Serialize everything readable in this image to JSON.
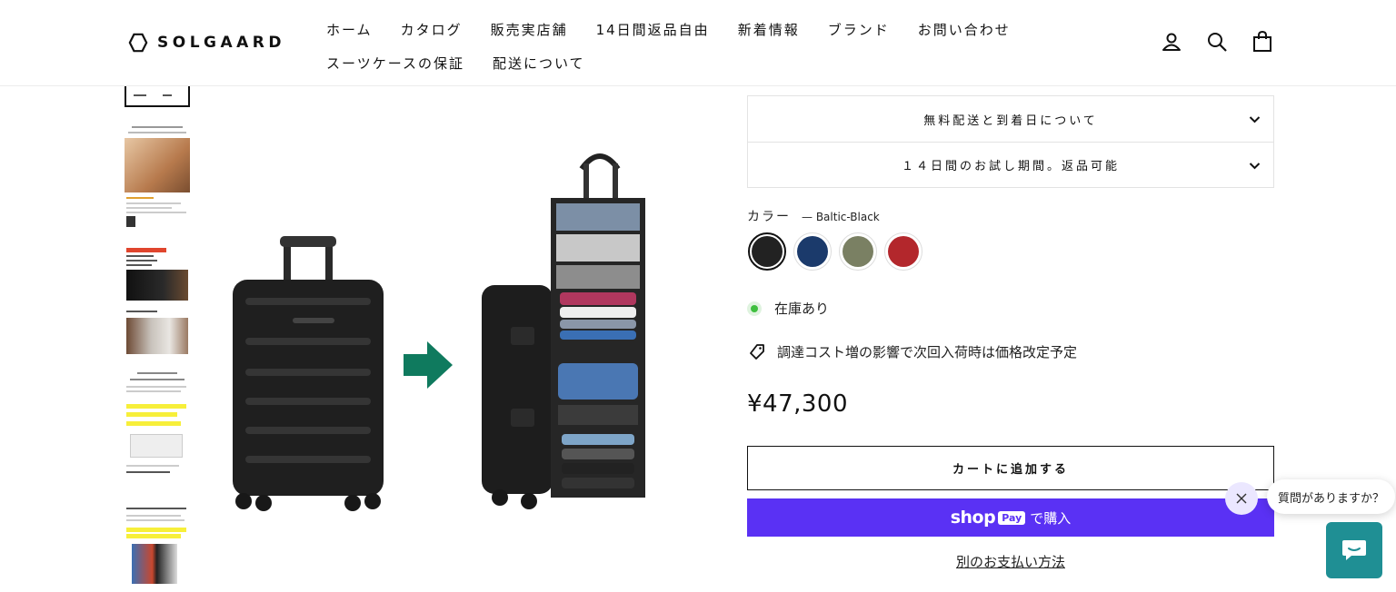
{
  "header": {
    "logo_text": "SOLGAARD",
    "nav_row1": [
      "ホーム",
      "カタログ",
      "販売実店舗",
      "14日間返品自由",
      "新着情報",
      "ブランド",
      "お問い合わせ"
    ],
    "nav_row2": [
      "スーツケースの保証",
      "配送について"
    ],
    "icons": [
      "account-icon",
      "search-icon",
      "cart-icon"
    ]
  },
  "accordion": [
    {
      "label": "無料配送と到着日について"
    },
    {
      "label": "１４日間のお試し期間。返品可能"
    }
  ],
  "color": {
    "label": "カラー",
    "value": "— Baltic-Black",
    "swatches": [
      {
        "name": "Baltic-Black",
        "color": "#222222",
        "selected": true
      },
      {
        "name": "navy",
        "color": "#1b3a6b",
        "selected": false
      },
      {
        "name": "olive",
        "color": "#7a8063",
        "selected": false
      },
      {
        "name": "red",
        "color": "#b3272c",
        "selected": false
      }
    ]
  },
  "stock_text": "在庫あり",
  "notice_text": "調達コスト増の影響で次回入荷時は価格改定予定",
  "price": "¥47,300",
  "add_to_cart": "カートに追加する",
  "shop_pay": {
    "word": "shop",
    "badge": "Pay",
    "suffix": "で購入"
  },
  "other_payment": "別のお支払い方法",
  "chat": {
    "bubble": "質問がありますか？"
  },
  "colors": {
    "accent": "#5a31f4",
    "chat": "#1f8f94",
    "arrow": "#0f7a5e",
    "stock": "#3fbf3f"
  }
}
